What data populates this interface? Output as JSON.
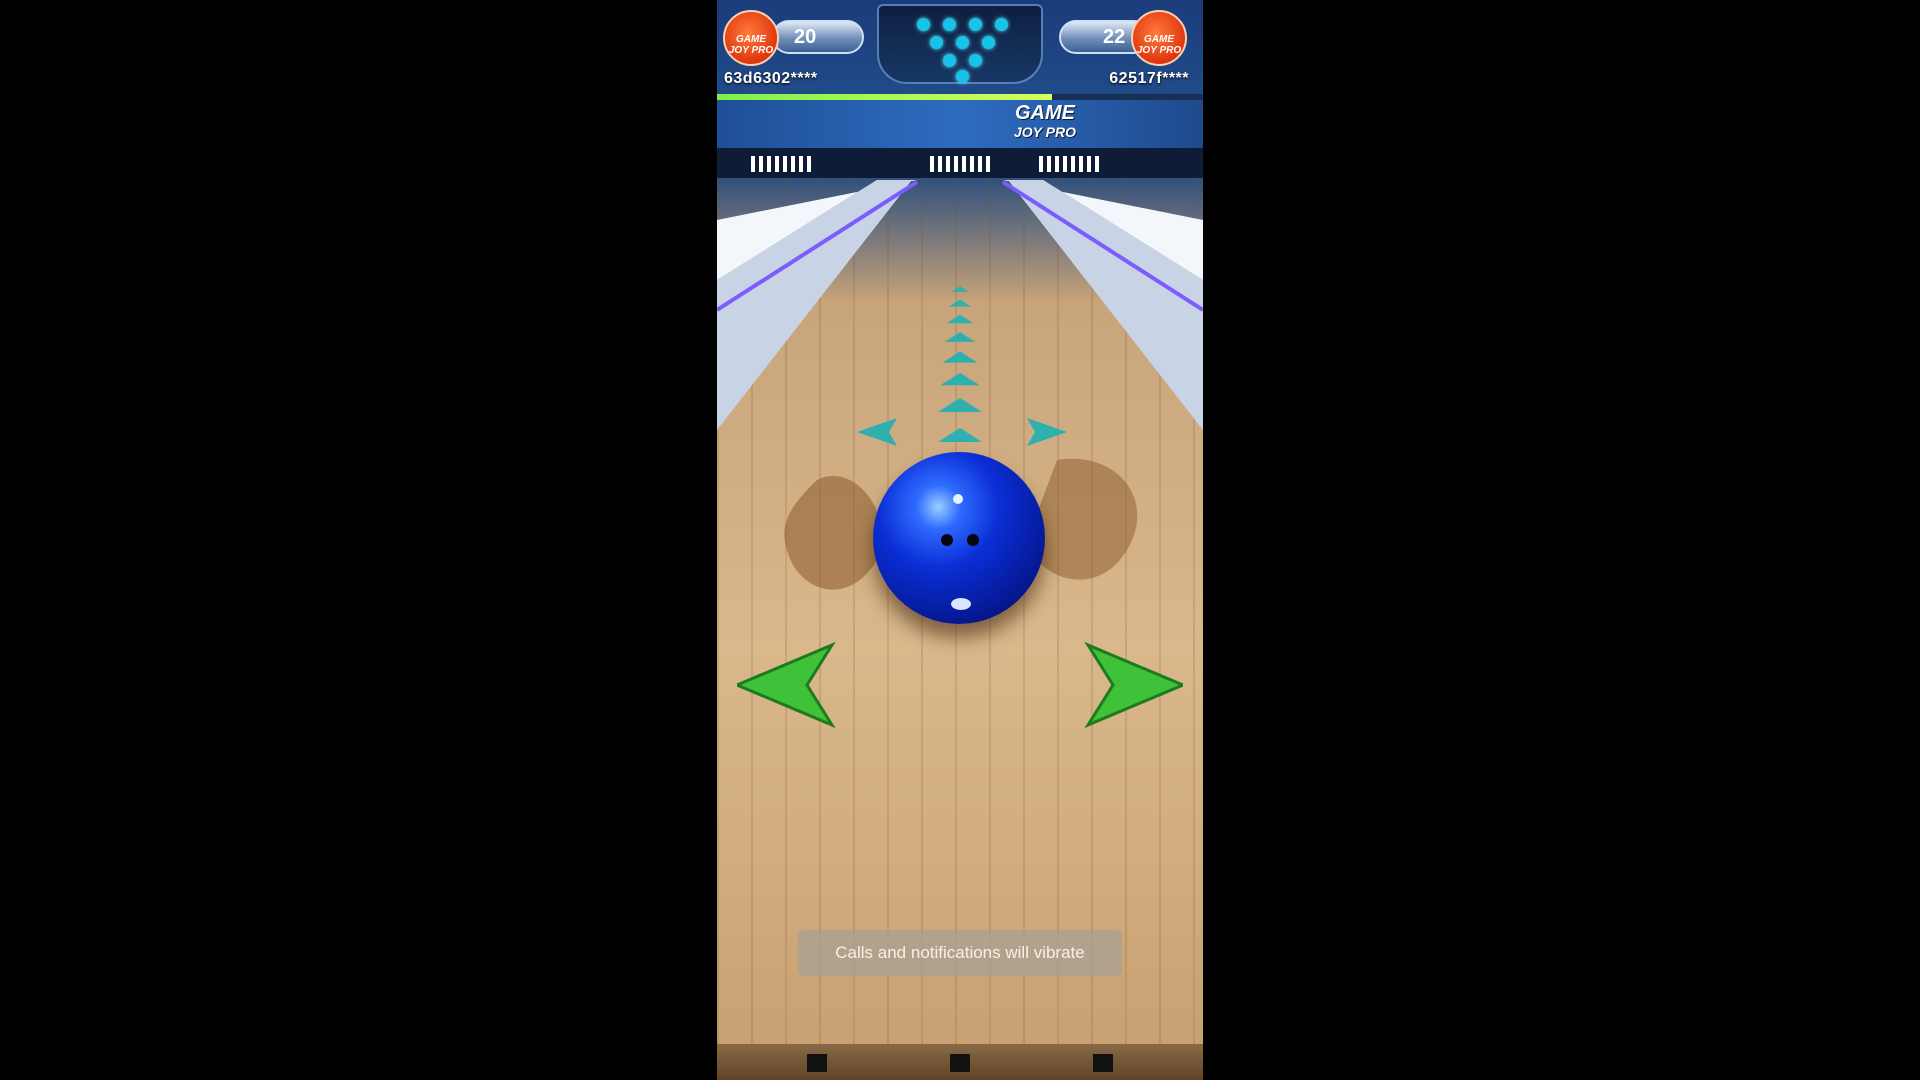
{
  "hud": {
    "player1": {
      "score": "20",
      "name": "63d6302****",
      "avatar_text": "GAME JOY PRO"
    },
    "player2": {
      "score": "22",
      "name": "62517f****",
      "avatar_text": "GAME JOY PRO"
    },
    "turn_progress": 0.69
  },
  "banner": {
    "logo_line1": "GAME",
    "logo_line2": "JOY PRO"
  },
  "toast": {
    "text": "Calls and notifications will vibrate"
  },
  "colors": {
    "ball": "#0a2fd6",
    "pin_dot": "#17c4e8",
    "aim_arrow": "#2fb0b0",
    "steer_arrow": "#3fc23a"
  },
  "icons": {
    "left_steer": "left-arrow-icon",
    "right_steer": "right-arrow-icon"
  }
}
